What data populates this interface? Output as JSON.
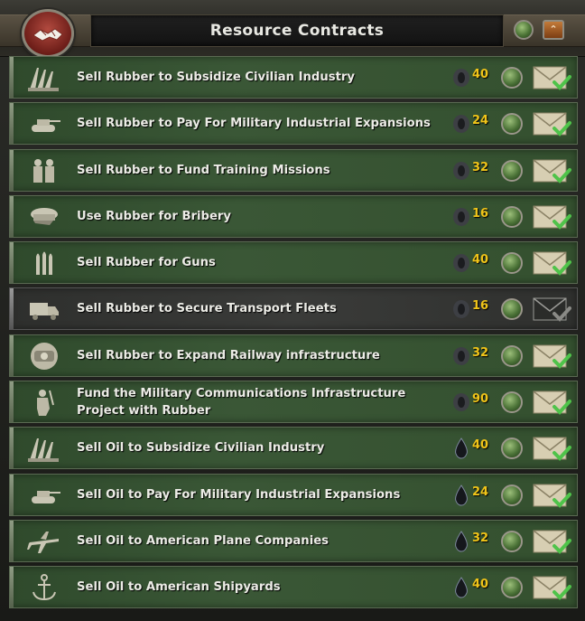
{
  "panel": {
    "title": "Resource Contracts",
    "collapse_glyph": "⌃"
  },
  "colors": {
    "cost": "#f0c419",
    "row_green": "#3a5736",
    "row_disabled": "#3a3b39"
  },
  "contracts": [
    {
      "label": "Sell Rubber to Subsidize Civilian Industry",
      "icon": "factory-icon",
      "resource": "rubber-icon",
      "cost": "40",
      "enabled": true
    },
    {
      "label": "Sell Rubber to Pay For Military Industrial Expansions",
      "icon": "tank-icon",
      "resource": "rubber-icon",
      "cost": "24",
      "enabled": true
    },
    {
      "label": "Sell Rubber to Fund Training Missions",
      "icon": "soldiers-icon",
      "resource": "rubber-icon",
      "cost": "32",
      "enabled": true
    },
    {
      "label": "Use Rubber for Bribery",
      "icon": "officer-cap-icon",
      "resource": "rubber-icon",
      "cost": "16",
      "enabled": true
    },
    {
      "label": "Sell Rubber for Guns",
      "icon": "bullets-icon",
      "resource": "rubber-icon",
      "cost": "40",
      "enabled": true
    },
    {
      "label": "Sell Rubber to Secure Transport Fleets",
      "icon": "truck-icon",
      "resource": "rubber-icon",
      "cost": "16",
      "enabled": false
    },
    {
      "label": "Sell Rubber to Expand Railway infrastructure",
      "icon": "train-icon",
      "resource": "rubber-icon",
      "cost": "32",
      "enabled": true
    },
    {
      "label": "Fund the Military Communications Infrastructure Project with Rubber",
      "icon": "radio-operator-icon",
      "resource": "rubber-icon",
      "cost": "90",
      "enabled": true
    },
    {
      "label": "Sell Oil to Subsidize Civilian Industry",
      "icon": "factory-icon",
      "resource": "oil-drop-icon",
      "cost": "40",
      "enabled": true
    },
    {
      "label": "Sell Oil to Pay For Military Industrial Expansions",
      "icon": "tank-icon",
      "resource": "oil-drop-icon",
      "cost": "24",
      "enabled": true
    },
    {
      "label": "Sell Oil to American Plane Companies",
      "icon": "plane-icon",
      "resource": "oil-drop-icon",
      "cost": "32",
      "enabled": true
    },
    {
      "label": "Sell Oil to American Shipyards",
      "icon": "anchor-icon",
      "resource": "oil-drop-icon",
      "cost": "40",
      "enabled": true
    }
  ]
}
